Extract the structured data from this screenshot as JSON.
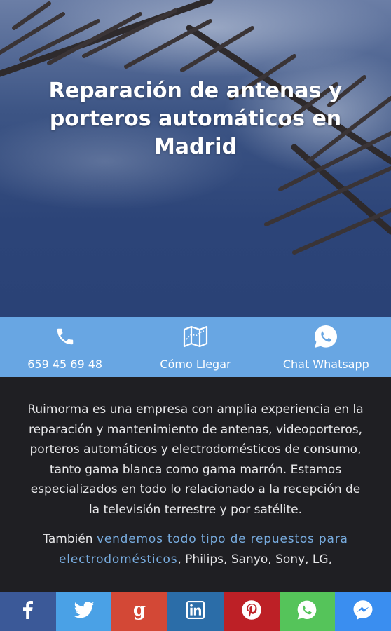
{
  "hero": {
    "title": "Reparación de antenas y porteros automáticos en Madrid"
  },
  "actions": [
    {
      "icon": "phone-icon",
      "label": "659 45 69 48"
    },
    {
      "icon": "map-icon",
      "label": "Cómo Llegar"
    },
    {
      "icon": "whatsapp-icon",
      "label": "Chat Whatsapp"
    }
  ],
  "content": {
    "paragraph1": "Ruimorma es una empresa con amplia experiencia en la reparación y mantenimiento de antenas, videoporteros, porteros automáticos y electrodomésticos de consumo, tanto gama blanca como gama marrón. Estamos especializados en todo lo relacionado a la recepción de la televisión terrestre y por satélite.",
    "p2_before": "También ",
    "p2_link": "vendemos todo tipo de repuestos para electrodomésticos",
    "p2_after": ", Philips, Sanyo, Sony, LG,"
  },
  "share": [
    {
      "icon": "facebook-icon",
      "color": "#3b5998"
    },
    {
      "icon": "twitter-icon",
      "color": "#4aa1e6"
    },
    {
      "icon": "google-plus-icon",
      "color": "#d34836"
    },
    {
      "icon": "linkedin-icon",
      "color": "#2b6da8"
    },
    {
      "icon": "pinterest-icon",
      "color": "#bd2026"
    },
    {
      "icon": "whatsapp-icon",
      "color": "#55c45a"
    },
    {
      "icon": "messenger-icon",
      "color": "#3a8ef0"
    }
  ],
  "colors": {
    "action_bar": "#68a6e3",
    "content_bg": "#1f1f23",
    "link": "#78acdf"
  }
}
